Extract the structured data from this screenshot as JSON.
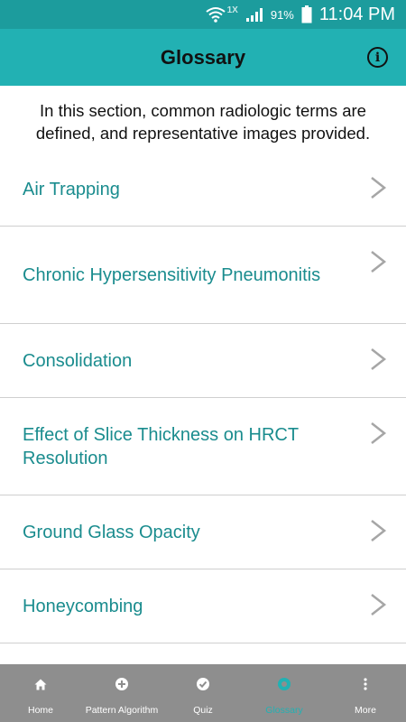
{
  "status_bar": {
    "network": "1X",
    "battery": "91%",
    "time": "11:04 PM",
    "icons": [
      "wifi-icon",
      "signal-icon",
      "battery-icon"
    ]
  },
  "header": {
    "title": "Glossary",
    "info_icon": "info-icon",
    "info_glyph": "i"
  },
  "intro": "In this section, common radiologic terms are defined, and representative images provided.",
  "glossary": {
    "items": [
      {
        "label": "Air Trapping"
      },
      {
        "label": "Chronic Hypersensitivity Pneumonitis"
      },
      {
        "label": "Consolidation"
      },
      {
        "label": "Effect of Slice Thickness on HRCT Resolution"
      },
      {
        "label": "Ground Glass Opacity"
      },
      {
        "label": "Honeycombing"
      }
    ]
  },
  "tabs": [
    {
      "label": "Home",
      "icon": "home-icon"
    },
    {
      "label": "Pattern Algorithm",
      "icon": "plus-circle-icon"
    },
    {
      "label": "Quiz",
      "icon": "check-circle-icon"
    },
    {
      "label": "Glossary",
      "icon": "glossary-icon",
      "active": true
    },
    {
      "label": "More",
      "icon": "more-vertical-icon"
    }
  ],
  "colors": {
    "status_bar": "#1c9c9d",
    "header": "#22b1b3",
    "link_text": "#1a8c8e",
    "tab_bar": "#8e8e8e",
    "active_tab": "#22b1b3"
  }
}
